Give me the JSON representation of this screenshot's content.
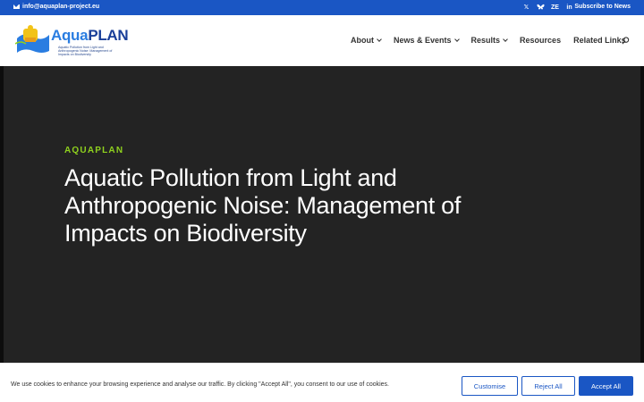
{
  "topbar": {
    "email": "info@aquaplan-project.eu",
    "social_icons": [
      "x-icon",
      "bluesky-icon",
      "zenodo-icon",
      "linkedin-icon"
    ],
    "social_glyphs": [
      "𝕏",
      "",
      "ZE",
      "in"
    ],
    "subscribe": "Subscribe to News"
  },
  "logo": {
    "name_part1": "Aqua",
    "name_part2": "PLAN",
    "tagline": "Aquatic Pollution from Light and Anthropogenic Noise: Management of Impacts on Biodiversity"
  },
  "nav": {
    "items": [
      {
        "label": "About",
        "has_dropdown": true
      },
      {
        "label": "News & Events",
        "has_dropdown": true
      },
      {
        "label": "Results",
        "has_dropdown": true
      },
      {
        "label": "Resources",
        "has_dropdown": false
      },
      {
        "label": "Related Links",
        "has_dropdown": false
      }
    ]
  },
  "hero": {
    "eyebrow": "AQUAPLAN",
    "headline": "Aquatic Pollution from Light and Anthropogenic Noise: Management of Impacts on Biodiversity"
  },
  "cookie": {
    "text": "We use cookies to enhance your browsing experience and analyse our traffic. By clicking \"Accept All\", you consent to our use of cookies.",
    "customise": "Customise",
    "reject": "Reject All",
    "accept": "Accept All"
  },
  "colors": {
    "topbar": "#1a56c4",
    "accent_green": "#8fd11e",
    "hero_bg": "#232323"
  }
}
